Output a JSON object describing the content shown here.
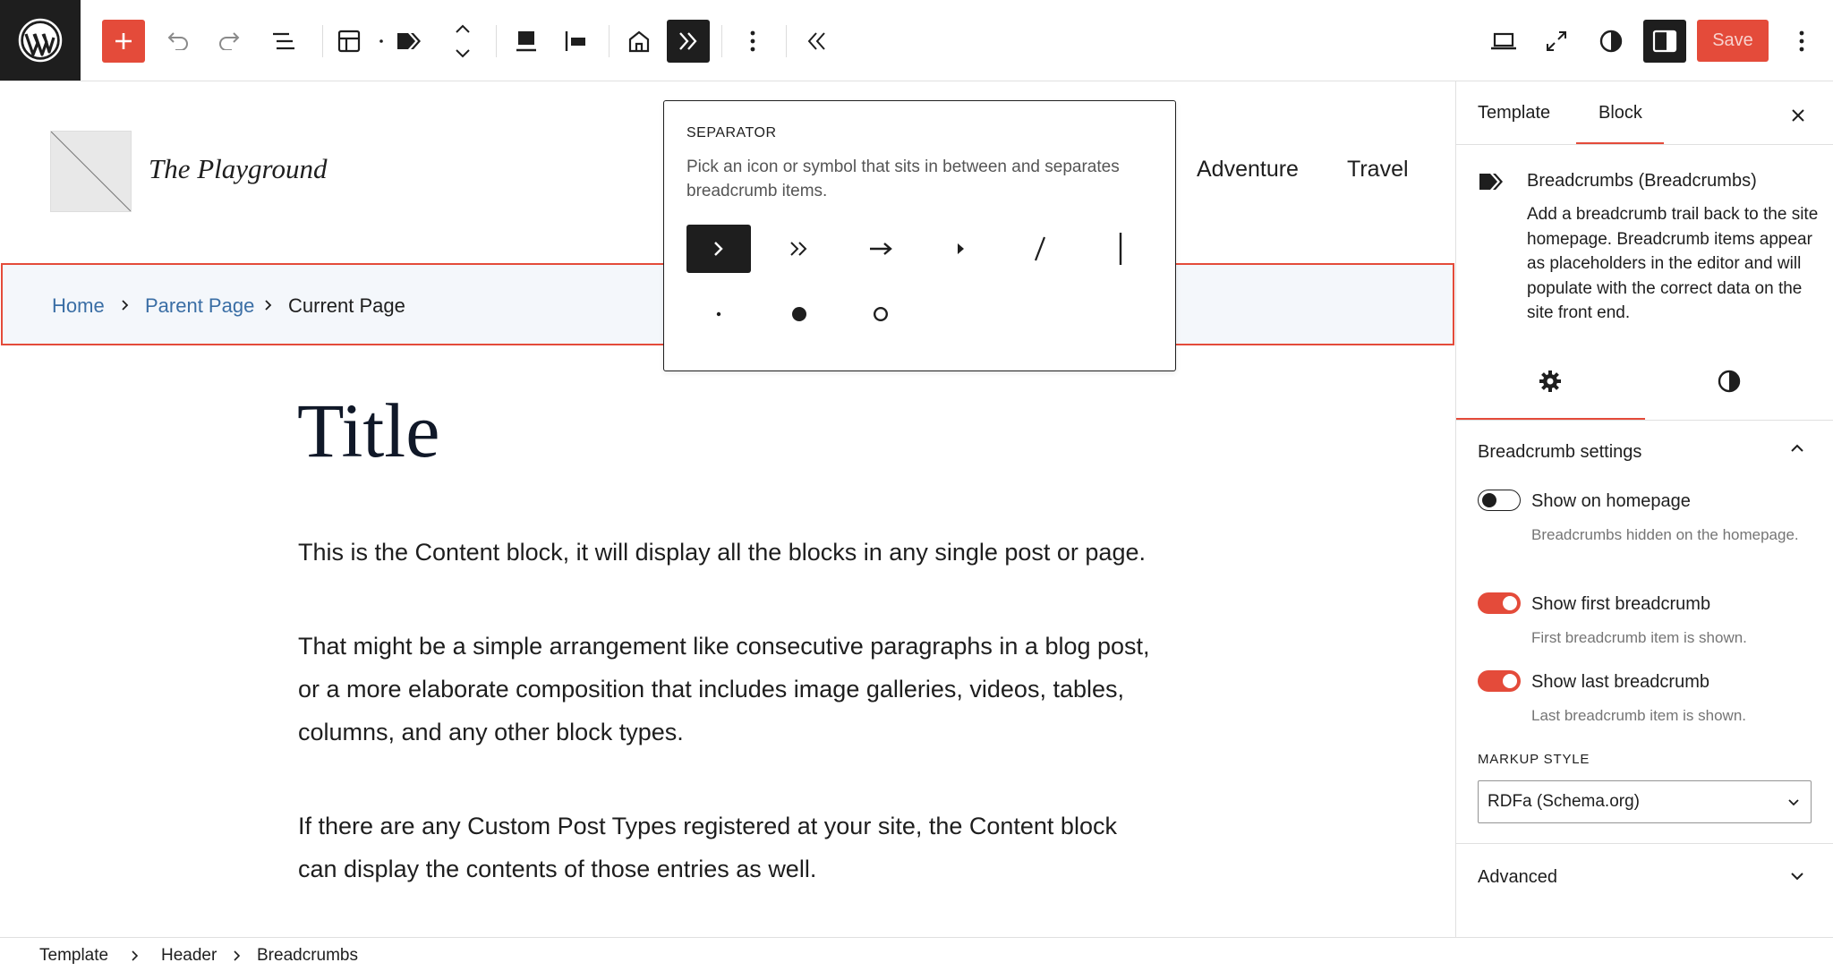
{
  "toolbar": {
    "logo_icon": "wordpress-logo",
    "save_label": "Save",
    "accent_color": "#e44b3a"
  },
  "canvas": {
    "site_title": "The Playground",
    "nav": [
      "Adventure",
      "Travel"
    ],
    "breadcrumbs": {
      "home": "Home",
      "parent": "Parent Page",
      "current": "Current Page"
    },
    "post_title": "Title",
    "paragraphs": [
      "This is the Content block, it will display all the blocks in any single post or page.",
      "That might be a simple arrangement like consecutive paragraphs in a blog post, or a more elaborate composition that includes image galleries, videos, tables, columns, and any other block types.",
      "If there are any Custom Post Types registered at your site, the Content block can display the contents of those entries as well."
    ]
  },
  "popover": {
    "heading": "SEPARATOR",
    "help": "Pick an icon or symbol that sits in between and separates breadcrumb items.",
    "selected": "chevron"
  },
  "sidebar": {
    "tabs": [
      "Template",
      "Block"
    ],
    "active_tab": "Block",
    "block_name": "Breadcrumbs (Breadcrumbs)",
    "block_description": "Add a breadcrumb trail back to the site homepage. Breadcrumb items appear as placeholders in the editor and will populate with the correct data on the site front end.",
    "panel_title": "Breadcrumb settings",
    "toggles": [
      {
        "label": "Show on homepage",
        "help": "Breadcrumbs hidden on the homepage.",
        "checked": false
      },
      {
        "label": "Show first breadcrumb",
        "help": "First breadcrumb item is shown.",
        "checked": true
      },
      {
        "label": "Show last breadcrumb",
        "help": "Last breadcrumb item is shown.",
        "checked": true
      }
    ],
    "markup_style_label": "MARKUP STYLE",
    "markup_style_value": "RDFa (Schema.org)",
    "advanced_label": "Advanced"
  },
  "bottom_breadcrumbs": [
    "Template",
    "Header",
    "Breadcrumbs"
  ]
}
